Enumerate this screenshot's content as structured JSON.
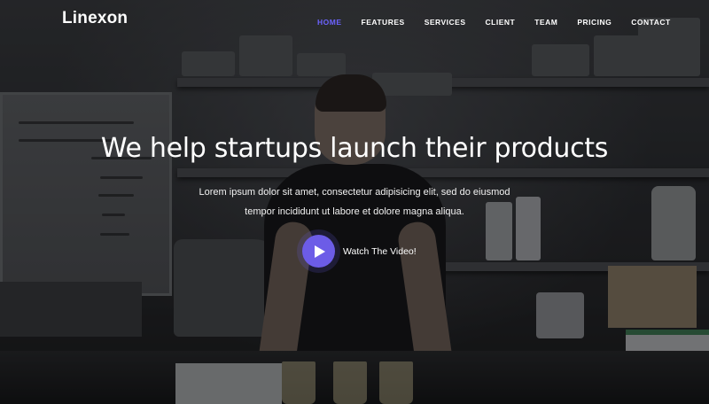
{
  "brand": {
    "logo_text": "Linexon"
  },
  "nav": {
    "items": [
      {
        "label": "HOME",
        "active": true
      },
      {
        "label": "FEATURES",
        "active": false
      },
      {
        "label": "SERVICES",
        "active": false
      },
      {
        "label": "CLIENT",
        "active": false
      },
      {
        "label": "TEAM",
        "active": false
      },
      {
        "label": "PRICING",
        "active": false
      },
      {
        "label": "CONTACT",
        "active": false
      }
    ]
  },
  "hero": {
    "title": "We help startups launch their products",
    "description_line1": "Lorem ipsum dolor sit amet, consectetur adipisicing elit, sed do eiusmod",
    "description_line2": "tempor incididunt ut labore et dolore magna aliqua.",
    "video_link_label": "Watch The Video!",
    "play_icon": "play-icon"
  },
  "colors": {
    "accent": "#6c5ce7",
    "active_nav": "#6c63ff",
    "text": "#ffffff"
  }
}
